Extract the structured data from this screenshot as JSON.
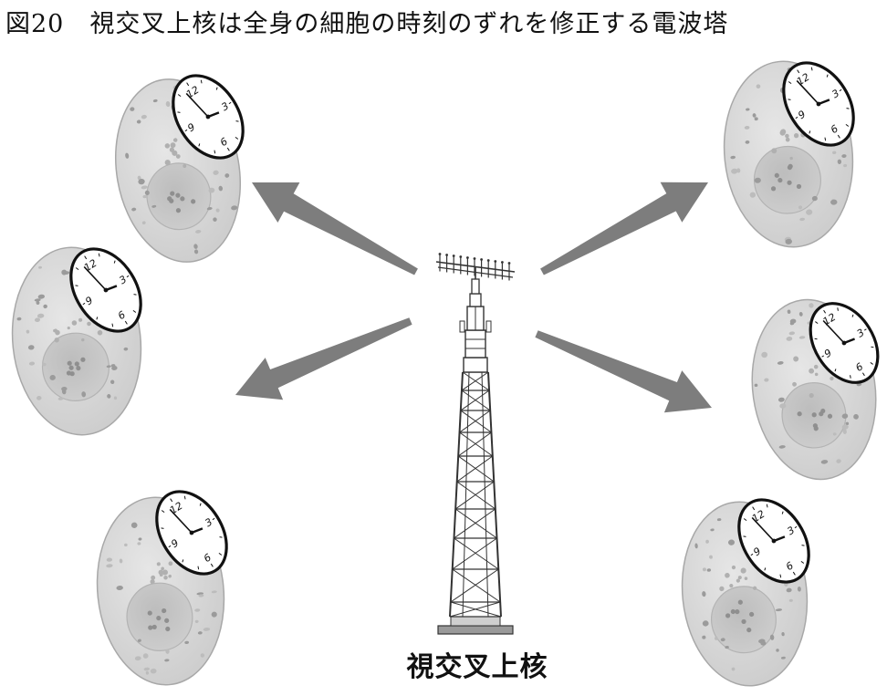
{
  "title": {
    "number": "図20",
    "text": "視交叉上核は全身の細胞の時刻のずれを修正する電波塔"
  },
  "tower": {
    "label": "視交叉上核"
  },
  "clock": {
    "numerals": [
      "12",
      "3",
      "6",
      "9"
    ]
  },
  "colors": {
    "arrow": "#7d7d7d",
    "cell_fill": "#d9d9d9",
    "cell_outline": "#a8a8a8",
    "nucleus_fill": "#c4c4c4",
    "tower_stroke": "#333333",
    "clock_rim": "#111111"
  }
}
